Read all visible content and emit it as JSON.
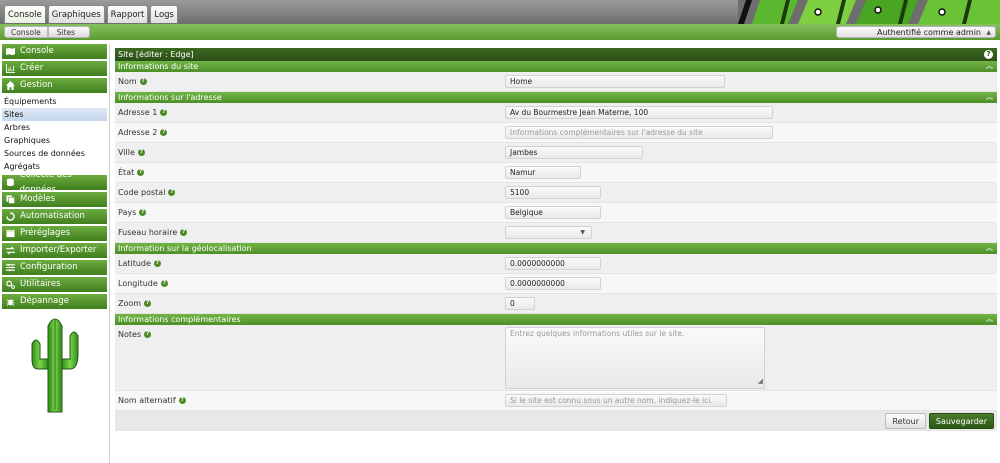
{
  "tabs": [
    "Console",
    "Graphiques",
    "Rapport",
    "Logs"
  ],
  "breadcrumbs": [
    "Console",
    "Sites"
  ],
  "auth": {
    "label": "Authentifié comme admin"
  },
  "sidebar": {
    "groups": [
      {
        "label": "Console",
        "icon": "map-icon"
      },
      {
        "label": "Créer",
        "icon": "chart-icon"
      },
      {
        "label": "Gestion",
        "icon": "home-icon"
      }
    ],
    "sub_items": [
      "Équipements",
      "Sites",
      "Arbres",
      "Graphiques",
      "Sources de données",
      "Agrégats"
    ],
    "groups2": [
      {
        "label": "Collecte des données",
        "icon": "database-icon"
      },
      {
        "label": "Modèles",
        "icon": "copy-icon"
      },
      {
        "label": "Automatisation",
        "icon": "refresh-icon"
      },
      {
        "label": "Préréglages",
        "icon": "preset-icon"
      },
      {
        "label": "Importer/Exporter",
        "icon": "exchange-icon"
      },
      {
        "label": "Configuration",
        "icon": "sliders-icon"
      },
      {
        "label": "Utilitaires",
        "icon": "cogs-icon"
      },
      {
        "label": "Dépannage",
        "icon": "bug-icon"
      }
    ]
  },
  "form": {
    "title": "Site [éditer : Edge]",
    "sections": {
      "site_info": "Informations du site",
      "address": "Informations sur l'adresse",
      "geo": "Information sur la géolocalisation",
      "extra": "Informations complémentaires"
    },
    "fields": {
      "name": {
        "label": "Nom",
        "value": "Home"
      },
      "address1": {
        "label": "Adresse 1",
        "value": "Av du Bourmestre Jean Materne, 100"
      },
      "address2": {
        "label": "Adresse 2",
        "placeholder": "Informations complémentaires sur l'adresse du site"
      },
      "city": {
        "label": "Ville",
        "value": "Jambes"
      },
      "state": {
        "label": "État",
        "value": "Namur"
      },
      "postal": {
        "label": "Code postal",
        "value": "5100"
      },
      "country": {
        "label": "Pays",
        "value": "Belgique"
      },
      "timezone": {
        "label": "Fuseau horaire",
        "value": ""
      },
      "latitude": {
        "label": "Latitude",
        "value": "0.0000000000"
      },
      "longitude": {
        "label": "Longitude",
        "value": "0.0000000000"
      },
      "zoom": {
        "label": "Zoom",
        "value": "0"
      },
      "notes": {
        "label": "Notes",
        "placeholder": "Entrez quelques informations utiles sur le site."
      },
      "alt_name": {
        "label": "Nom alternatif",
        "placeholder": "Si le site est connu sous un autre nom, indiquez-le ici."
      }
    },
    "buttons": {
      "back": "Retour",
      "save": "Sauvegarder"
    }
  },
  "colors": {
    "accent": "#4d8f28",
    "title_bar": "#2a4e15"
  }
}
